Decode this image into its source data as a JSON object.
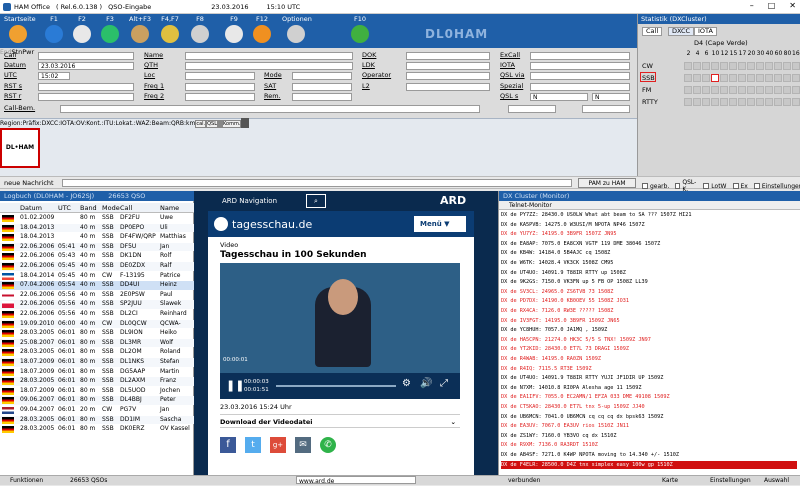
{
  "titlebar": {
    "app": "HAM Office",
    "version": "( Rel.6.0.138 )",
    "window": "QSO-Eingabe",
    "date": "23.03.2016",
    "time": "15:10 UTC"
  },
  "toolbar": {
    "items": [
      "Startseite",
      "F1",
      "F2",
      "F3",
      "Alt+F3",
      "F4,F7",
      "F8",
      "F9",
      "F12",
      "Optionen",
      "F10"
    ],
    "callsign_display": "DL0HAM"
  },
  "form": {
    "left_labels": [
      "Call",
      "Datum",
      "UTC",
      "RST s",
      "RST r",
      "Call-Bem."
    ],
    "date_value": "23.03.2016",
    "utc_value": "15:02",
    "end_label": "End",
    "mid_labels": [
      "Name",
      "QTH",
      "Loc",
      "Freq 1",
      "Freq 2"
    ],
    "mode_labels": [
      "Mode",
      "SAT",
      "Rem."
    ],
    "right_labels": [
      "DOK",
      "LDK",
      "Operator",
      "L2"
    ],
    "far_labels": [
      "ExCall",
      "IOTA",
      "QSL via",
      "Spezial",
      "QSL s"
    ],
    "qsl_s_value": "N",
    "qsl_s_value2": "N",
    "stn_label": "Stn",
    "pwr_label": "Pwr"
  },
  "lower": {
    "labels": [
      "Region:",
      "Präfix:",
      "DXCC:",
      "IOTA:",
      "OV:"
    ],
    "mid_labels": [
      "Kont.:",
      "ITU:"
    ],
    "right_labels": [
      "Lokat.:",
      "WAZ:",
      "Beam:",
      "QRB:"
    ],
    "km": "km",
    "buttons": [
      "cal.",
      "QSL",
      "",
      "",
      "Komm."
    ],
    "logo_text": "DL•HAM"
  },
  "statistik": {
    "title": "Statistik (DXCluster)",
    "tabs": [
      "Call",
      "DXCC",
      "IOTA"
    ],
    "country": "D4 (Cape Verde)",
    "bands": [
      "2",
      "4",
      "6",
      "10",
      "12",
      "15",
      "17",
      "20",
      "30",
      "40",
      "60",
      "80",
      "160"
    ],
    "rows": [
      "CW",
      "SSB",
      "FM",
      "RTTY"
    ]
  },
  "message": {
    "label": "neue Nachricht",
    "button": "PAM zu HAM",
    "checks": [
      "gearb.",
      "QSL-K.",
      "LotW",
      "Ex",
      "Einstellungen"
    ]
  },
  "logbook": {
    "title": "Logbuch (DL0HAM - JO62SJ)",
    "count": "26653 QSO",
    "columns": [
      "Datum",
      "UTC",
      "Band",
      "Mode",
      "Call",
      "Name"
    ],
    "rows": [
      [
        "01.02.2009",
        "",
        "80 m",
        "SSB",
        "DF2FU",
        "Uwe"
      ],
      [
        "18.04.2013",
        "",
        "40 m",
        "SSB",
        "DP0EPO",
        "Uli"
      ],
      [
        "18.04.2013",
        "",
        "40 m",
        "SSB",
        "DF4FW/QRP",
        "Matthias"
      ],
      [
        "22.06.2006",
        "05:41",
        "40 m",
        "SSB",
        "DF5U",
        "Jan"
      ],
      [
        "22.06.2006",
        "05:43",
        "40 m",
        "SSB",
        "DK1DN",
        "Rolf"
      ],
      [
        "22.06.2006",
        "05:45",
        "40 m",
        "SSB",
        "DE0ZDX",
        "Ralf"
      ],
      [
        "18.04.2014",
        "05:45",
        "40 m",
        "CW",
        "F-13195",
        "Patrice"
      ],
      [
        "07.04.2006",
        "05:54",
        "40 m",
        "SSB",
        "DD4UI",
        "Heinz"
      ],
      [
        "22.06.2006",
        "05:56",
        "40 m",
        "SSB",
        "2E0PSW",
        "Paul"
      ],
      [
        "22.06.2006",
        "05:56",
        "40 m",
        "SSB",
        "SP2JUU",
        "Slawek"
      ],
      [
        "22.06.2006",
        "05:56",
        "40 m",
        "SSB",
        "DL2CI",
        "Reinhard"
      ],
      [
        "19.09.2010",
        "06:00",
        "40 m",
        "CW",
        "DL0QCW",
        "QCWA-"
      ],
      [
        "28.03.2005",
        "06:01",
        "80 m",
        "SSB",
        "DL9ION",
        "Heiko"
      ],
      [
        "25.08.2007",
        "06:01",
        "80 m",
        "SSB",
        "DL3MR",
        "Wolf"
      ],
      [
        "28.03.2005",
        "06:01",
        "80 m",
        "SSB",
        "DL2OM",
        "Roland"
      ],
      [
        "18.07.2009",
        "06:01",
        "80 m",
        "SSB",
        "DL1NKS",
        "Stefan"
      ],
      [
        "18.07.2009",
        "06:01",
        "80 m",
        "SSB",
        "DG5AAP",
        "Martin"
      ],
      [
        "28.03.2005",
        "06:01",
        "80 m",
        "SSB",
        "DL2AXM",
        "Franz"
      ],
      [
        "18.07.2009",
        "06:01",
        "80 m",
        "SSB",
        "DL5UOD",
        "Jochen"
      ],
      [
        "09.06.2007",
        "06:01",
        "80 m",
        "SSB",
        "DL4BBJ",
        "Peter"
      ],
      [
        "09.04.2007",
        "06:01",
        "20 m",
        "CW",
        "PG7V",
        "Jan"
      ],
      [
        "28.03.2005",
        "06:01",
        "80 m",
        "SSB",
        "DD1IM",
        "Sascha"
      ],
      [
        "28.03.2005",
        "06:01",
        "80 m",
        "SSB",
        "DK0ERZ",
        "OV Kassel"
      ]
    ],
    "footer_btn": "Funktionen",
    "footer_count": "26653 QSOs"
  },
  "browser": {
    "nav_title": "ARD Navigation",
    "brand": "ARD",
    "site": "tagesschau.de",
    "menu": "Menü",
    "kicker": "Video",
    "headline": "Tagesschau in 100 Sekunden",
    "time_a": "00:00:01",
    "time_b": "00:00:03",
    "time_c": "00:01:51",
    "date": "23.03.2016 15:24 Uhr",
    "download": "Download der Videodatei",
    "url": "www.ard.de"
  },
  "dxcluster": {
    "title": "DX Cluster (Monitor)",
    "subtitle": "Telnet-Monitor",
    "rows": [
      {
        "t": "DX de PY7ZZ:     28430.0  US0LW        What abt beam to SA ???     1507Z HI21",
        "c": "#000"
      },
      {
        "t": "DX de KA5PVB:    14275.0  W3USI/M      NPOTA NP46              1507Z",
        "c": "#000"
      },
      {
        "t": "DX de YU7YZ:     14195.0  3B9FR                                 1507Z JN95",
        "c": "#e02020"
      },
      {
        "t": "DX de EA8AP:     7075.0  EA8CXN       VGTF 119 DME 38046       1507Z",
        "c": "#000"
      },
      {
        "t": "DX de KB4W:      14184.0  5B4AJC       cq                      1508Z",
        "c": "#000"
      },
      {
        "t": "DX de W6TK:      14028.4  VK3CK                                 1508Z CM95",
        "c": "#000"
      },
      {
        "t": "DX de UT4UO:     14091.9  T88IR        RTTY  up                 1508Z",
        "c": "#000"
      },
      {
        "t": "DX de 9K2GS:     7150.0  VK3FN        up 5 FB OP               1508Z LL39",
        "c": "#000"
      },
      {
        "t": "DX de SV3CL:     24965.0  ZS6TVB       73                       1508Z",
        "c": "#e02020"
      },
      {
        "t": "DX de PD7DX:     14190.0  KB0OEV       55                       1508Z JO31",
        "c": "#e02020"
      },
      {
        "t": "DX de RX4CA:     7126.0  RW3E         ?????                    1508Z",
        "c": "#e02020"
      },
      {
        "t": "DX de IV3FGT:    14195.0  3B9FR                                 1509Z JN65",
        "c": "#e02020"
      },
      {
        "t": "DX de YC8HUH:    7057.0  JA1MQ        ,                        1509Z",
        "c": "#000"
      },
      {
        "t": "DX de HA5CPN:    21274.0  HK3C         5/5 S TNX!               1509Z JN97",
        "c": "#e02020"
      },
      {
        "t": "DX de YT2KID:    28430.0  ET7L         73 DRAGI                 1509Z",
        "c": "#e02020"
      },
      {
        "t": "DX de R4WAB:     14195.0  RA0ZN                                 1509Z",
        "c": "#e02020"
      },
      {
        "t": "DX de R4IQ:      7115.5  RT3E                                  1509Z",
        "c": "#e02020"
      },
      {
        "t": "DX de UT4UO:     14091.9  T88IR        RTTY  YUJI  JF1DIR  UP    1509Z",
        "c": "#000"
      },
      {
        "t": "DX de N7XM:      14010.8  RI0PA        Alesha  age 11          1509Z",
        "c": "#000"
      },
      {
        "t": "DX de EA1IFV:    7055.0  EC2AMN/1     EFZA  033  DME 49108     1509Z",
        "c": "#e02020"
      },
      {
        "t": "DX de CT5KAO:    28430.0  ET7L         tnx 5-up                 1509Z JJ40",
        "c": "#e02020"
      },
      {
        "t": "DX de UB6MCN:    7041.0  UB6MCN       cq cq cq dx  bpsk63      1509Z",
        "c": "#000"
      },
      {
        "t": "DX de EA3UV:     7067.0  EA3UV        rios                     1510Z JN11",
        "c": "#e02020"
      },
      {
        "t": "DX de ZS1WY:     7160.0  YB3VO        cq dx                    1510Z",
        "c": "#000"
      },
      {
        "t": "DX de R9XM:      7136.0  RA3RDT                                1510Z",
        "c": "#e02020"
      },
      {
        "t": "DX de AB4SF:     7271.0  K4WP         NPOTA moving to 14.340 +/-  1510Z",
        "c": "#000"
      },
      {
        "t": "DX de F4ELR:     28500.0  D4Z          tnx simplex easy 100w gp    1510Z",
        "c": "#fff",
        "bg": "#d01010"
      }
    ]
  },
  "status": {
    "left_btn": "Funktionen",
    "left_count": "26653 QSOs",
    "mid": "verbunden",
    "karte": "Karte",
    "einstellungen": "Einstellungen",
    "auswahl": "Auswahl"
  },
  "colors": {
    "accent": "#1f5fa8",
    "dx_red": "#e02020"
  }
}
